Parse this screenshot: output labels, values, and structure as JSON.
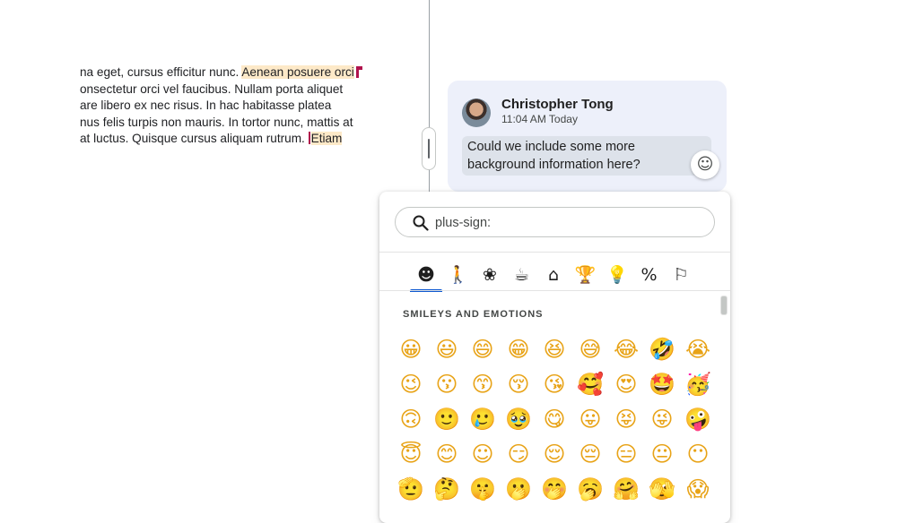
{
  "document": {
    "lines": [
      {
        "before": "na eget, cursus efficitur nunc. ",
        "highlight": "Aenean posuere orci",
        "after": ""
      },
      {
        "before": "onsectetur orci vel faucibus. Nullam porta aliquet",
        "highlight": "",
        "after": ""
      },
      {
        "before": "are libero ex nec risus. In hac habitasse platea",
        "highlight": "",
        "after": ""
      },
      {
        "before": "nus felis turpis non mauris. In tortor nunc, mattis at",
        "highlight": "",
        "after": ""
      },
      {
        "before": "at luctus. Quisque cursus aliquam rutrum. ",
        "highlight": "Etiam",
        "after": ""
      }
    ]
  },
  "comment": {
    "author": "Christopher Tong",
    "timestamp": "11:04 AM Today",
    "text_lines": [
      "Could we include some more",
      "background information here?"
    ],
    "react_icon": "smiley-icon"
  },
  "picker": {
    "search": {
      "value": "plus-sign:",
      "icon": "search-icon"
    },
    "tabs": [
      {
        "name": "tab-smileys",
        "glyph": "☻",
        "active": true
      },
      {
        "name": "tab-people",
        "glyph": "🚶",
        "active": false
      },
      {
        "name": "tab-animals",
        "glyph": "❀",
        "active": false
      },
      {
        "name": "tab-food",
        "glyph": "☕",
        "active": false
      },
      {
        "name": "tab-travel",
        "glyph": "⌂",
        "active": false
      },
      {
        "name": "tab-activities",
        "glyph": "🏆",
        "active": false
      },
      {
        "name": "tab-objects",
        "glyph": "💡",
        "active": false
      },
      {
        "name": "tab-symbols",
        "glyph": "%",
        "active": false
      },
      {
        "name": "tab-flags",
        "glyph": "⚐",
        "active": false
      }
    ],
    "section_title": "SMILEYS AND EMOTIONS",
    "emoji_rows": [
      [
        "😀",
        "😃",
        "😄",
        "😁",
        "😆",
        "😅",
        "😂",
        "🤣",
        "😭"
      ],
      [
        "😉",
        "😗",
        "😙",
        "😚",
        "😘",
        "🥰",
        "😍",
        "🤩",
        "🥳"
      ],
      [
        "🙃",
        "🙂",
        "🥲",
        "🥹",
        "😋",
        "😛",
        "😝",
        "😜",
        "🤪"
      ],
      [
        "😇",
        "😊",
        "☺",
        "😏",
        "😌",
        "😔",
        "😑",
        "😐",
        "😶"
      ],
      [
        "🫡",
        "🤔",
        "🤫",
        "🫢",
        "🤭",
        "🥱",
        "🤗",
        "🫣",
        "😱"
      ]
    ]
  },
  "colors": {
    "accent": "#0b57d0",
    "highlight": "#fde9c8",
    "comment_bg": "#edf0fa",
    "cursor": "#b0124c"
  }
}
